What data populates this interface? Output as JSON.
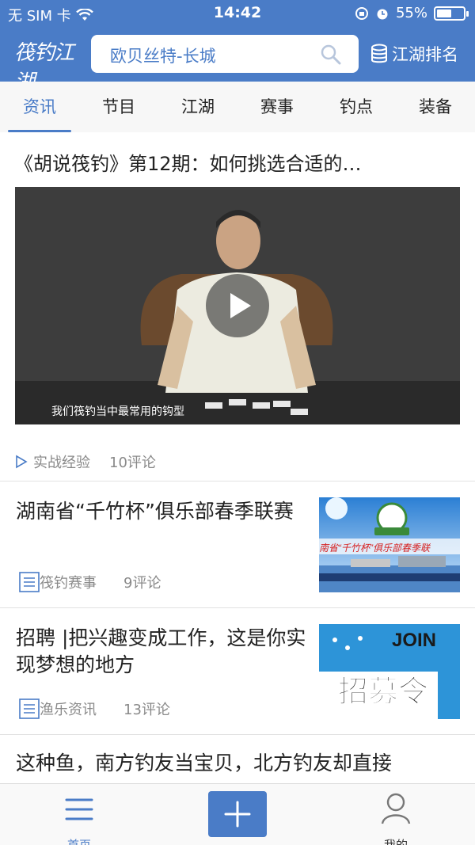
{
  "status_bar": {
    "carrier": "无 SIM 卡",
    "time": "14:42",
    "battery_percent": "55%",
    "battery_level": 0.55
  },
  "header": {
    "logo_text": "筏钓江湖",
    "search_text": "欧贝丝特-长城",
    "rank_label": "江湖排名"
  },
  "tabs": [
    "资讯",
    "节目",
    "江湖",
    "赛事",
    "钓点",
    "装备"
  ],
  "active_tab": 0,
  "feed": {
    "video_item": {
      "title": "《胡说筏钓》第12期：如何挑选合适的…",
      "subtitle": "我们筏钓当中最常用的钩型",
      "tag": "实战经验",
      "comments": "10评论"
    },
    "articles": [
      {
        "title": "湖南省“千竹杯”俱乐部春季联赛",
        "tag": "筏钓赛事",
        "comments": "9评论",
        "thumb_banner": "南省“千竹杯”俱乐部春季联"
      },
      {
        "title": "招聘 |把兴趣变成工作，这是你实现梦想的地方",
        "tag": "渔乐资讯",
        "comments": "13评论",
        "thumb_join": "JOIN",
        "thumb_text": "招募令"
      },
      {
        "title": "这种鱼，南方钓友当宝贝，北方钓友却直接"
      }
    ]
  },
  "bottom_nav": {
    "home_label": "首页",
    "me_label": "我的"
  },
  "colors": {
    "brand": "#4a7cc7",
    "text": "#222222",
    "muted": "#8a8a8a"
  }
}
